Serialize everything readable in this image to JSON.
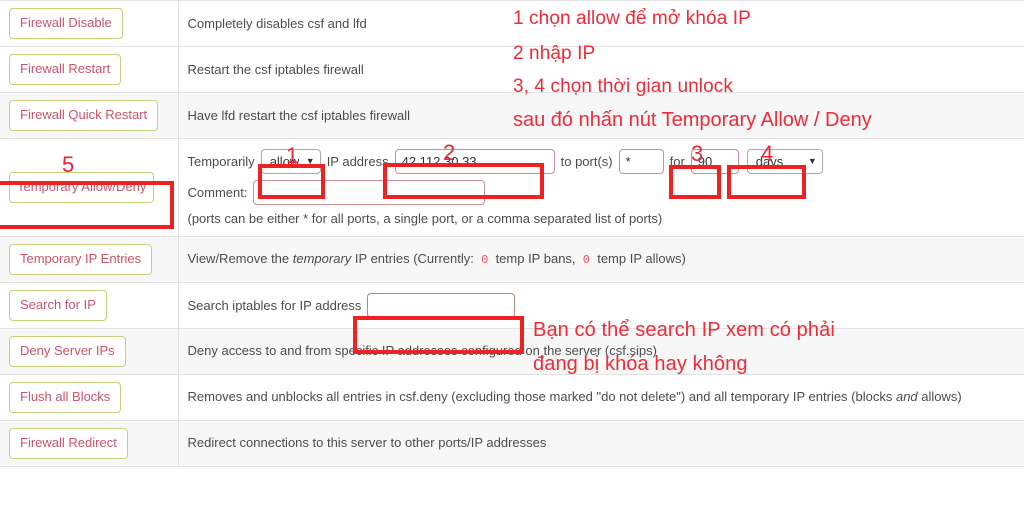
{
  "colors": {
    "button_border": "#c6cf7e",
    "button_text": "#c9556b",
    "annotation_red": "#ee2b38",
    "row_alt_bg": "#f7f7f7",
    "input_border": "#c98f92",
    "count_red": "#e8546b"
  },
  "rows": [
    {
      "button": "Firewall Disable",
      "description": "Completely disables csf and lfd"
    },
    {
      "button": "Firewall Restart",
      "description": "Restart the csf iptables firewall"
    },
    {
      "button": "Firewall Quick Restart",
      "description": "Have lfd restart the csf iptables firewall"
    },
    {
      "button": "Temporary Allow/Deny",
      "description": ""
    },
    {
      "button": "Temporary IP Entries",
      "description": "View/Remove the temporary IP entries (Currently:  0  temp IP bans,  0  temp IP allows)"
    },
    {
      "button": "Search for IP",
      "description": "Search iptables for IP address"
    },
    {
      "button": "Deny Server IPs",
      "description": "Deny access to and from specific IP addresses configured on the server (csf.sips)"
    },
    {
      "button": "Flush all Blocks",
      "description": "Removes and unblocks all entries in csf.deny (excluding those marked \"do not delete\") and all temporary IP entries (blocks and allows)"
    },
    {
      "button": "Firewall Redirect",
      "description": "Redirect connections to this server to other ports/IP addresses"
    }
  ],
  "temp_form": {
    "label_temporarily": "Temporarily",
    "action_value": "allow",
    "action_caret": "▼",
    "label_ip_address": "IP address",
    "ip_value": "42.112.30.33",
    "label_to_ports": "to port(s)",
    "port_value": "*",
    "label_for": "for",
    "duration_value": "90",
    "unit_value": "days",
    "unit_caret": "▼",
    "label_comment": "Comment:",
    "comment_value": "",
    "comment_placeholder": "",
    "hint": "(ports can be either * for all ports, a single port, or a comma separated list of ports)"
  },
  "temp_entries": {
    "prefix": "View/Remove the ",
    "italic": "temporary",
    "mid": " IP entries (Currently:",
    "bans_count": "0",
    "bans_label": "temp IP bans,",
    "allows_count": "0",
    "allows_label": "temp IP allows)"
  },
  "search_row": {
    "label": "Search iptables for IP address",
    "value": "",
    "placeholder": ""
  },
  "flush_row": {
    "part1": "Removes and unblocks all entries in csf.deny (excluding those marked \"do not delete\") and all temporary IP entries (blocks ",
    "italic": "and",
    "part2": " allows)"
  },
  "annotations": {
    "note_line1": "1 chọn allow để mở khóa IP",
    "note_line2": "2 nhập IP",
    "note_line3": "3, 4 chọn thời gian unlock",
    "note_line4": "sau đó nhấn nút Temporary Allow / Deny",
    "search_note_line1": "Bạn có thể search IP xem có phải",
    "search_note_line2": "đang bị khóa hay không",
    "num1": "1",
    "num2": "2",
    "num3": "3",
    "num4": "4",
    "num5": "5"
  }
}
